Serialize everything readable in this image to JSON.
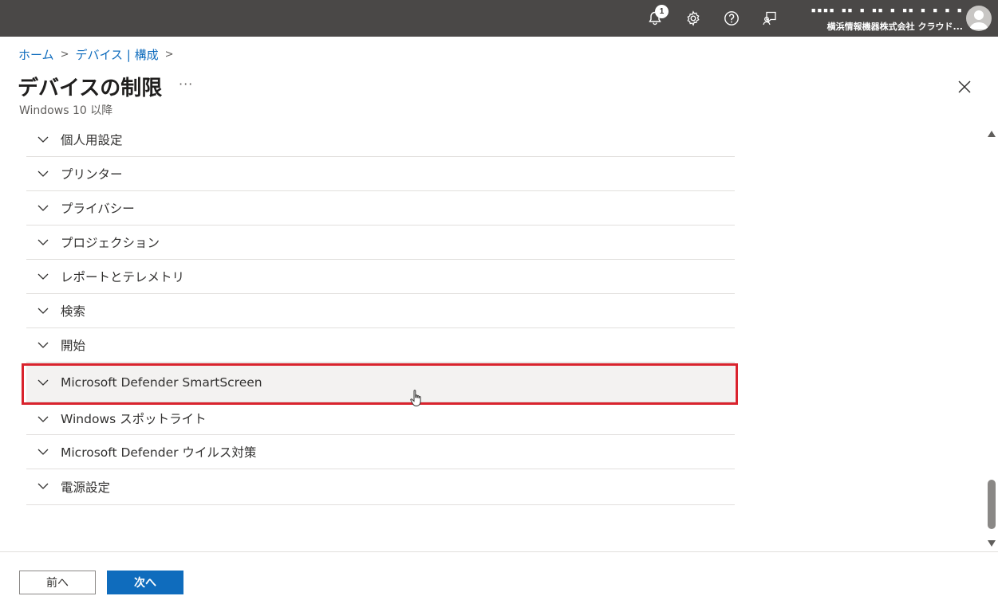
{
  "topbar": {
    "notification_count": "1",
    "account_masked": "▪▪▪▪ ▪▪ ▪ ▪▪ ▪ ▪▪ ▪ ▪ ▪ ▪",
    "account_org": "横浜情報機器株式会社 クラウド...",
    "icons": [
      "bell-icon",
      "gear-icon",
      "help-icon",
      "feedback-icon",
      "avatar-icon"
    ]
  },
  "breadcrumb": {
    "items": [
      "ホーム",
      "デバイス | 構成"
    ]
  },
  "page": {
    "title": "デバイスの制限",
    "more": "···",
    "subtitle": "Windows 10 以降"
  },
  "sections": [
    {
      "label": "個人用設定"
    },
    {
      "label": "プリンター"
    },
    {
      "label": "プライバシー"
    },
    {
      "label": "プロジェクション"
    },
    {
      "label": "レポートとテレメトリ"
    },
    {
      "label": "検索"
    },
    {
      "label": "開始"
    },
    {
      "label": "Microsoft Defender SmartScreen"
    },
    {
      "label": "Windows スポットライト"
    },
    {
      "label": "Microsoft Defender ウイルス対策"
    },
    {
      "label": "電源設定"
    }
  ],
  "footer": {
    "prev_label": "前へ",
    "next_label": "次へ"
  },
  "colors": {
    "topbar": "#4a4847",
    "link": "#0f6cbd",
    "primary_button": "#0f6cbd",
    "highlight": "#d9232d",
    "hover_row": "#f3f2f1"
  }
}
